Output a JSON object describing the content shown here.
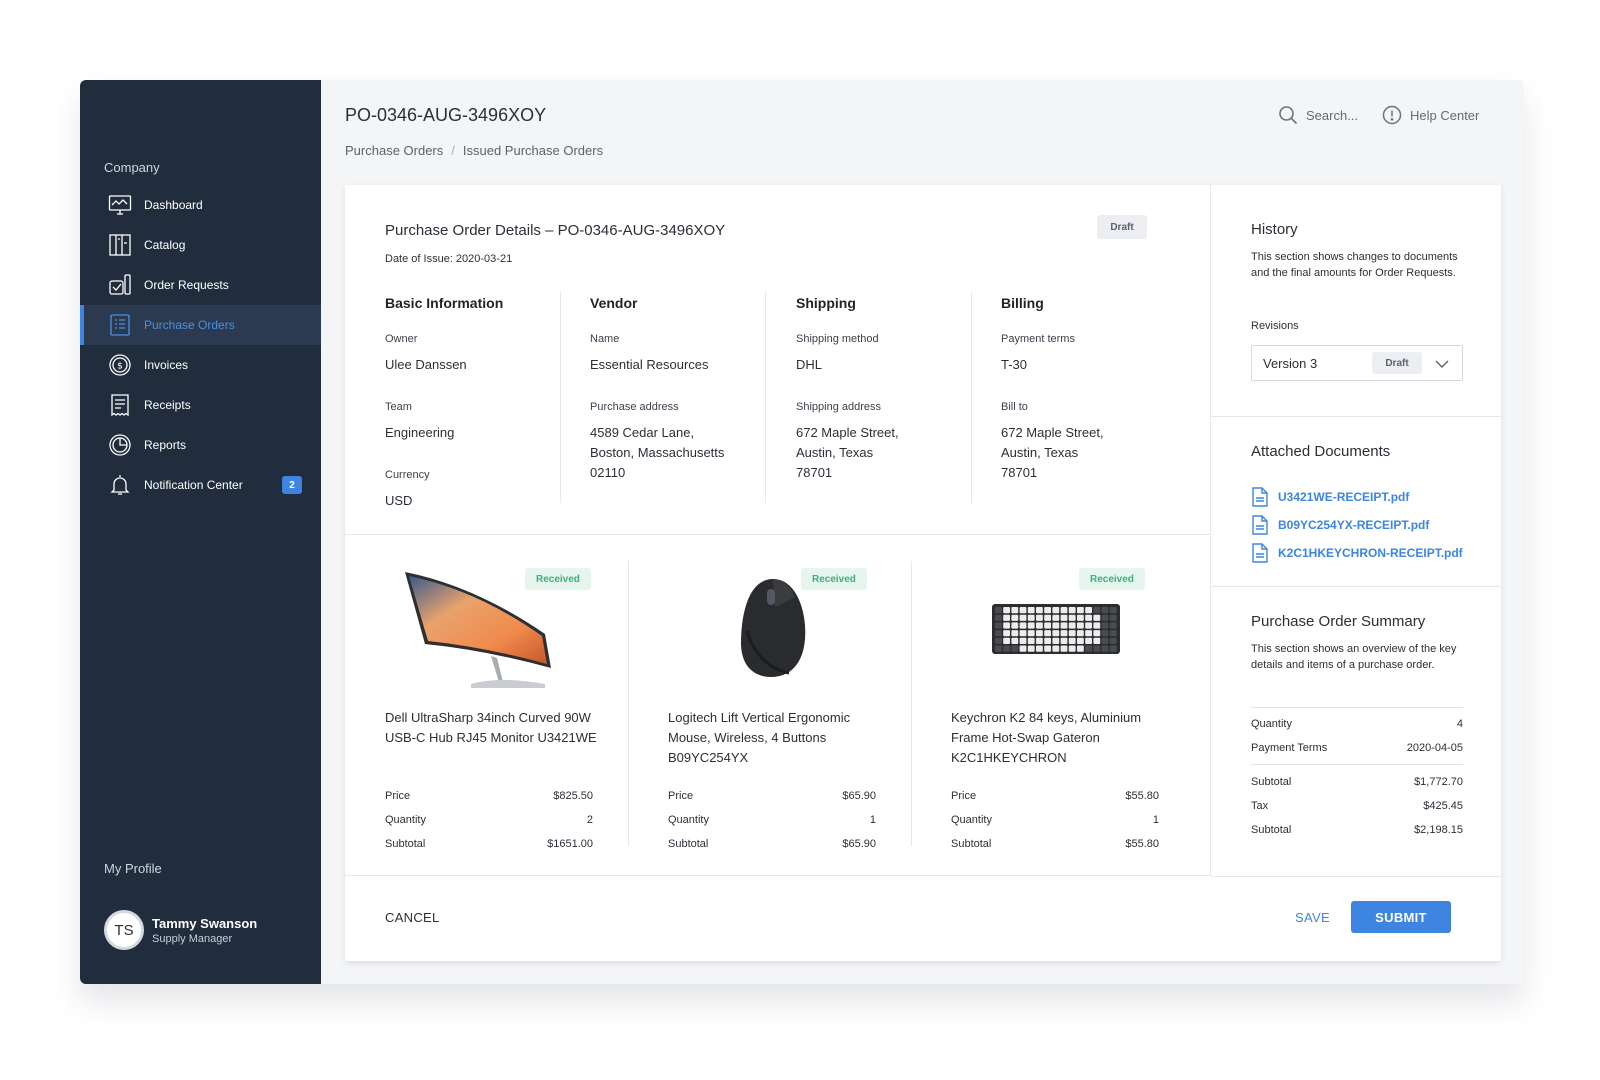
{
  "sidebar": {
    "company_label": "Company",
    "items": [
      {
        "label": "Dashboard",
        "icon": "dashboard-icon"
      },
      {
        "label": "Catalog",
        "icon": "catalog-icon"
      },
      {
        "label": "Order Requests",
        "icon": "order-requests-icon"
      },
      {
        "label": "Purchase Orders",
        "icon": "purchase-orders-icon",
        "active": true
      },
      {
        "label": "Invoices",
        "icon": "invoices-icon"
      },
      {
        "label": "Receipts",
        "icon": "receipts-icon"
      },
      {
        "label": "Reports",
        "icon": "reports-icon"
      },
      {
        "label": "Notification Center",
        "icon": "bell-icon",
        "badge": "2"
      }
    ],
    "profile_label": "My Profile",
    "profile": {
      "initials": "TS",
      "name": "Tammy Swanson",
      "role": "Supply Manager"
    }
  },
  "header": {
    "title": "PO-0346-AUG-3496XOY",
    "breadcrumb": [
      "Purchase Orders",
      "Issued Purchase Orders"
    ],
    "search_placeholder": "Search...",
    "help_label": "Help Center"
  },
  "details": {
    "title": "Purchase Order Details – PO-0346-AUG-3496XOY",
    "status": "Draft",
    "issue_date": "Date of Issue: 2020-03-21",
    "sections": {
      "basic": {
        "title": "Basic Information",
        "owner_label": "Owner",
        "owner": "Ulee Danssen",
        "team_label": "Team",
        "team": "Engineering",
        "currency_label": "Currency",
        "currency": "USD"
      },
      "vendor": {
        "title": "Vendor",
        "name_label": "Name",
        "name": "Essential Resources",
        "address_label": "Purchase address",
        "address": "4589 Cedar Lane,\nBoston, Massachusetts\n02110"
      },
      "shipping": {
        "title": "Shipping",
        "method_label": "Shipping method",
        "method": "DHL",
        "address_label": "Shipping address",
        "address": "672 Maple Street,\nAustin, Texas\n78701"
      },
      "billing": {
        "title": "Billing",
        "terms_label": "Payment terms",
        "terms": "T-30",
        "bill_label": "Bill to",
        "bill_to": "672 Maple Street,\nAustin, Texas\n78701"
      }
    }
  },
  "products": [
    {
      "status": "Received",
      "name": "Dell UltraSharp 34inch Curved 90W USB-C Hub RJ45 Monitor U3421WE",
      "price_label": "Price",
      "price": "$825.50",
      "qty_label": "Quantity",
      "qty": "2",
      "subtotal_label": "Subtotal",
      "subtotal": "$1651.00"
    },
    {
      "status": "Received",
      "name": "Logitech Lift Vertical Ergonomic Mouse, Wireless, 4 Buttons B09YC254YX",
      "price_label": "Price",
      "price": "$65.90",
      "qty_label": "Quantity",
      "qty": "1",
      "subtotal_label": "Subtotal",
      "subtotal": "$65.90"
    },
    {
      "status": "Received",
      "name": "Keychron K2 84 keys, Aluminium Frame Hot-Swap Gateron K2C1HKEYCHRON",
      "price_label": "Price",
      "price": "$55.80",
      "qty_label": "Quantity",
      "qty": "1",
      "subtotal_label": "Subtotal",
      "subtotal": "$55.80"
    }
  ],
  "history": {
    "title": "History",
    "description": "This section shows changes to documents and the final amounts for Order Requests.",
    "revisions_label": "Revisions",
    "selected_revision": "Version 3",
    "selected_revision_status": "Draft"
  },
  "attachments": {
    "title": "Attached Documents",
    "files": [
      "U3421WE-RECEIPT.pdf",
      "B09YC254YX-RECEIPT.pdf",
      "K2C1HKEYCHRON-RECEIPT.pdf"
    ]
  },
  "summary": {
    "title": "Purchase Order Summary",
    "description": "This section shows an overview of the key details and items of a purchase order.",
    "quantity_label": "Quantity",
    "quantity": "4",
    "payment_terms_label": "Payment Terms",
    "payment_terms": "2020-04-05",
    "subtotal_label": "Subtotal",
    "subtotal": "$1,772.70",
    "tax_label": "Tax",
    "tax": "$425.45",
    "total_label": "Subtotal",
    "total": "$2,198.15"
  },
  "actions": {
    "cancel": "CANCEL",
    "save": "SAVE",
    "submit": "SUBMIT"
  },
  "colors": {
    "sidebar_bg": "#212d3d",
    "accent": "#3d85e0",
    "received_green": "#3fae7c"
  }
}
